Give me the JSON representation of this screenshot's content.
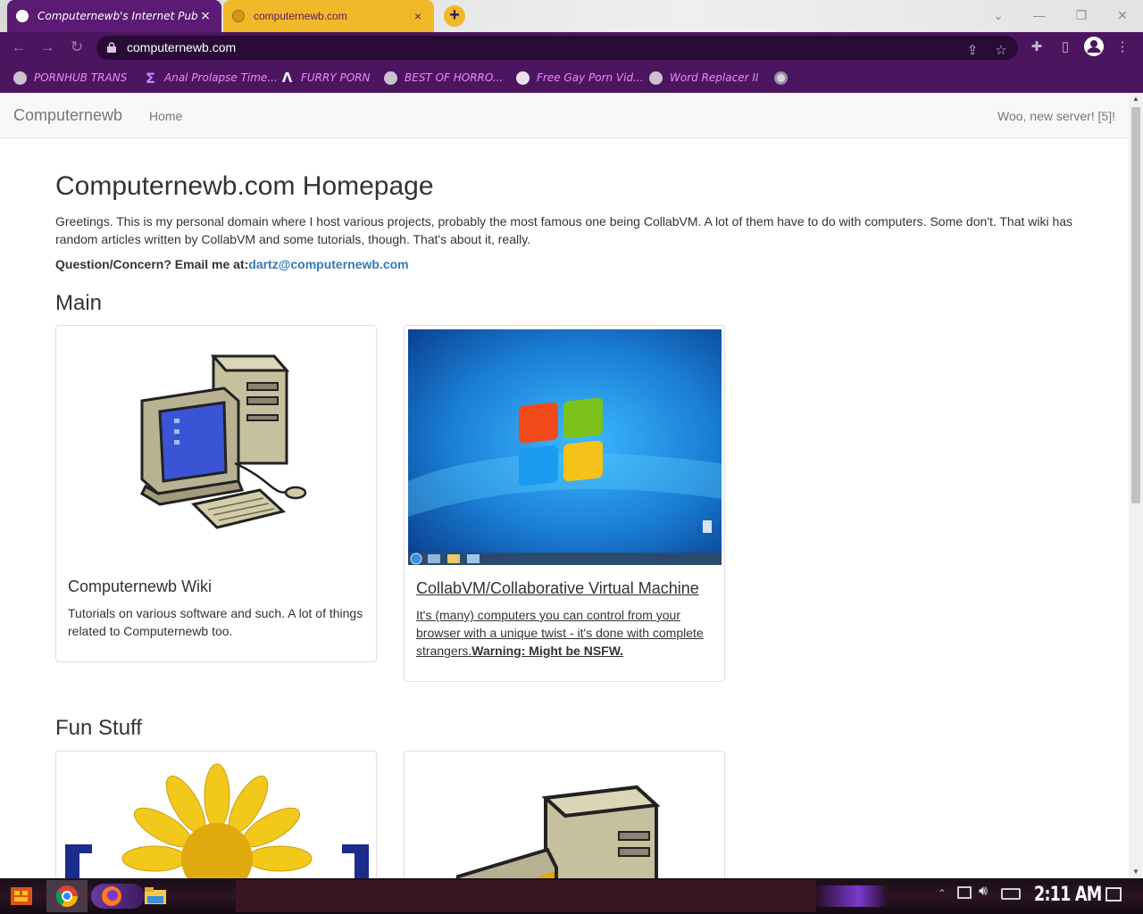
{
  "browser": {
    "tabs": [
      {
        "title": "Computernewb's Internet Pub",
        "close": "×"
      },
      {
        "title": "computernewb.com",
        "close": "×"
      }
    ],
    "new_tab": "+",
    "url": "computernewb.com",
    "bookmarks": [
      {
        "label": "PORNHUB TRANS",
        "icon": "globe-icon"
      },
      {
        "label": "Anal Prolapse Time...",
        "icon": "bracket-icon"
      },
      {
        "label": "FURRY PORN",
        "icon": "lambda-icon"
      },
      {
        "label": "BEST OF HORRO...",
        "icon": "globe-icon"
      },
      {
        "label": "Free Gay Porn Vid...",
        "icon": "skull-icon"
      },
      {
        "label": "Word Replacer II",
        "icon": "globe-icon"
      }
    ],
    "colors": {
      "frame": "#4c155f",
      "active_tab": "#f0b929",
      "bookmark_text": "#ee88ff"
    }
  },
  "site": {
    "brand": "Computernewb",
    "nav_home": "Home",
    "nav_right": "Woo, new server! [5]!",
    "heading": "Computernewb.com Homepage",
    "intro": "Greetings. This is my personal domain where I host various projects, probably the most famous one being CollabVM. A lot of them have to do with computers. Some don't. That wiki has random articles written by CollabVM and some tutorials, though. That's about it, really.",
    "contact_label": "Question/Concern? Email me at:",
    "contact_email": "dartz@computernewb.com",
    "section_main": "Main",
    "section_fun": "Fun Stuff",
    "cards": {
      "wiki": {
        "title": "Computernewb Wiki",
        "text": "Tutorials on various software and such. A lot of things related to Computernewb too."
      },
      "collab": {
        "title": "CollabVM/Collaborative Virtual Machine",
        "text": "It's (many) computers you can control from your browser with a unique twist - it's done with complete strangers.",
        "warning": "Warning: Might be NSFW."
      }
    }
  },
  "taskbar": {
    "clock": "2:11 AM"
  }
}
